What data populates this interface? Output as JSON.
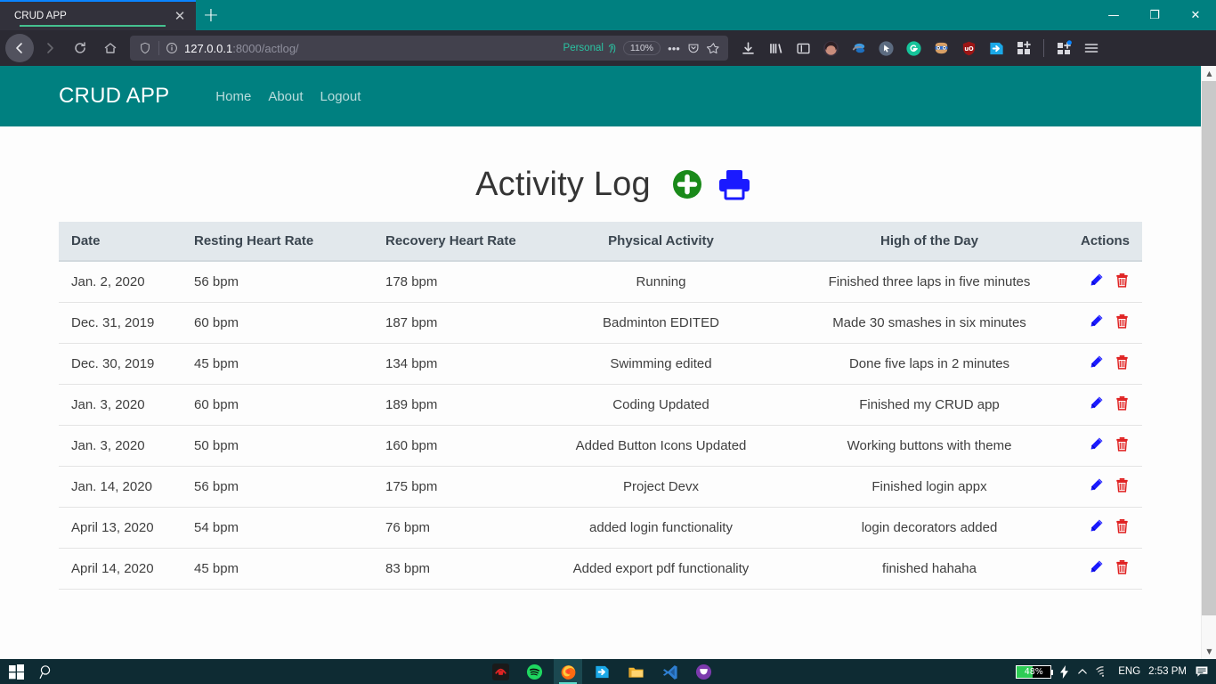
{
  "browser": {
    "tab": {
      "title": "CRUD APP",
      "close_label": "✕"
    },
    "newtab_label": "+",
    "window_controls": {
      "minimize": "—",
      "restore": "❐",
      "close": "✕"
    },
    "toolbar": {
      "back_label": "←",
      "forward_label": "→",
      "reload_label": "⟳",
      "home_label": "⌂",
      "url_host": "127.0.0.1",
      "url_path": ":8000/actlog/",
      "container_label": "Personal",
      "zoom_label": "110%",
      "menu_dots": "•••",
      "pocket_label": "save-to-pocket",
      "bookmark_label": "☆"
    },
    "extensions": [
      "downloads-icon",
      "library-icon",
      "sidebar-icon",
      "account-avatar-icon",
      "clipper-icon",
      "cursor-icon",
      "grammarly-icon",
      "goggles-icon",
      "ublock-origin-icon",
      "export-icon",
      "apps-add-icon"
    ],
    "tray_extensions": [
      "extensions-badge-icon",
      "app-menu-icon"
    ]
  },
  "site": {
    "brand": "CRUD APP",
    "nav_links": [
      "Home",
      "About",
      "Logout"
    ],
    "page_title": "Activity Log",
    "actions": {
      "add_label": "add-record",
      "print_label": "print-records"
    }
  },
  "table": {
    "columns": [
      "Date",
      "Resting Heart Rate",
      "Recovery Heart Rate",
      "Physical Activity",
      "High of the Day",
      "Actions"
    ],
    "rows": [
      {
        "date": "Jan. 2, 2020",
        "resting": "56 bpm",
        "recovery": "178 bpm",
        "activity": "Running",
        "high": "Finished three laps in five minutes"
      },
      {
        "date": "Dec. 31, 2019",
        "resting": "60 bpm",
        "recovery": "187 bpm",
        "activity": "Badminton EDITED",
        "high": "Made 30 smashes in six minutes"
      },
      {
        "date": "Dec. 30, 2019",
        "resting": "45 bpm",
        "recovery": "134 bpm",
        "activity": "Swimming edited",
        "high": "Done five laps in 2 minutes"
      },
      {
        "date": "Jan. 3, 2020",
        "resting": "60 bpm",
        "recovery": "189 bpm",
        "activity": "Coding Updated",
        "high": "Finished my CRUD app"
      },
      {
        "date": "Jan. 3, 2020",
        "resting": "50 bpm",
        "recovery": "160 bpm",
        "activity": "Added Button Icons Updated",
        "high": "Working buttons with theme"
      },
      {
        "date": "Jan. 14, 2020",
        "resting": "56 bpm",
        "recovery": "175 bpm",
        "activity": "Project Devx",
        "high": "Finished login appx"
      },
      {
        "date": "April 13, 2020",
        "resting": "54 bpm",
        "recovery": "76 bpm",
        "activity": "added login functionality",
        "high": "login decorators added"
      },
      {
        "date": "April 14, 2020",
        "resting": "45 bpm",
        "recovery": "83 bpm",
        "activity": "Added export pdf functionality",
        "high": "finished hahaha"
      }
    ],
    "row_action_labels": {
      "edit": "edit-record",
      "delete": "delete-record"
    }
  },
  "taskbar": {
    "start_label": "start-menu",
    "search_label": "search",
    "apps": [
      "red-app-icon",
      "spotify-icon",
      "firefox-icon",
      "export-app-icon",
      "file-explorer-icon",
      "vscode-icon",
      "purple-app-icon"
    ],
    "tray": {
      "battery_percent": "48%",
      "battery_value": 48,
      "charging": "⚡",
      "chevron": "︿",
      "network": "wifi-icon",
      "language": "ENG",
      "time": "2:53 PM",
      "notifications": "notification-icon"
    }
  },
  "colors": {
    "teal": "#008080",
    "accent_green": "#1a8a1a",
    "accent_blue": "#1a1aff",
    "delete_red": "#e02020",
    "header_bg": "#e2e8ec"
  }
}
